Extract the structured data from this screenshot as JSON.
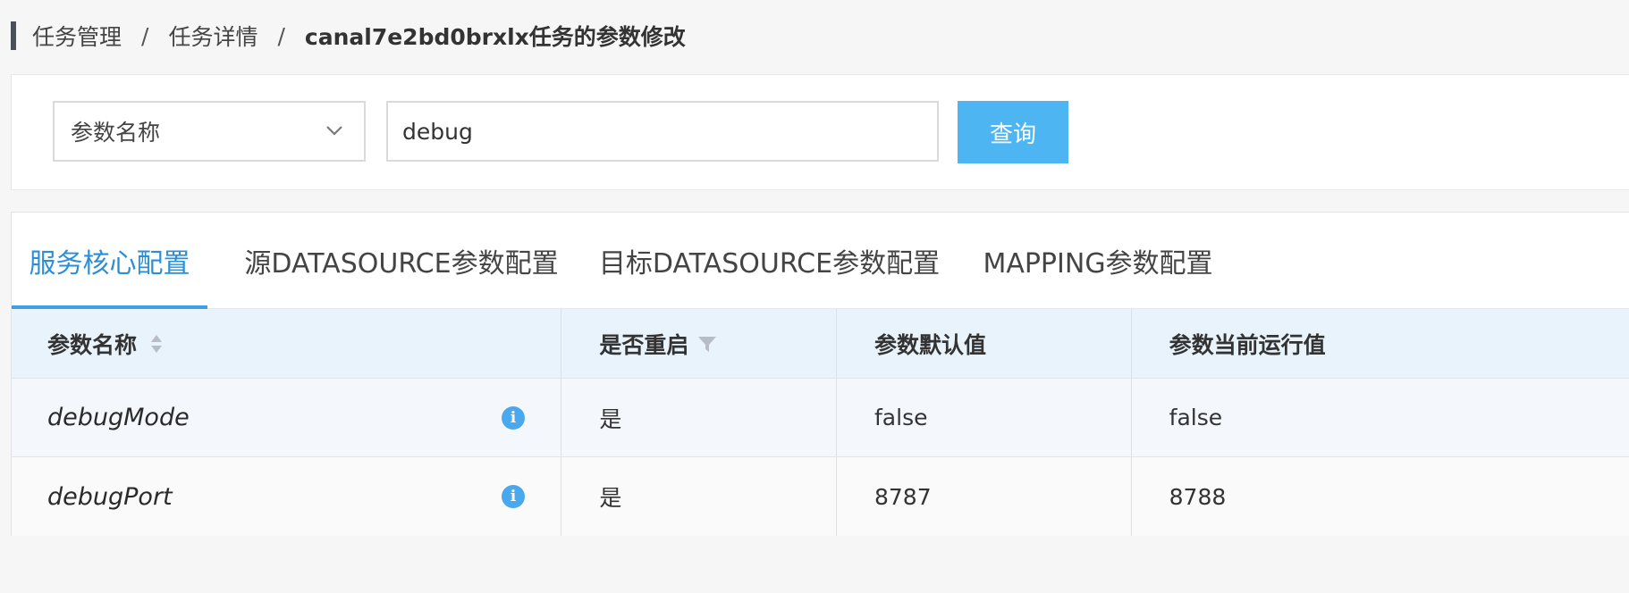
{
  "breadcrumb": {
    "items": [
      "任务管理",
      "任务详情"
    ],
    "separator": "/",
    "current": "canal7e2bd0brxlx任务的参数修改"
  },
  "search": {
    "select_value": "参数名称",
    "input_value": "debug",
    "query_label": "查询"
  },
  "tabs": [
    {
      "label": "服务核心配置",
      "active": true
    },
    {
      "label": "源DATASOURCE参数配置",
      "active": false
    },
    {
      "label": "目标DATASOURCE参数配置",
      "active": false
    },
    {
      "label": "MAPPING参数配置",
      "active": false
    }
  ],
  "table": {
    "columns": [
      "参数名称",
      "是否重启",
      "参数默认值",
      "参数当前运行值"
    ],
    "rows": [
      {
        "name": "debugMode",
        "restart": "是",
        "default": "false",
        "current": "false"
      },
      {
        "name": "debugPort",
        "restart": "是",
        "default": "8787",
        "current": "8788"
      }
    ]
  },
  "icons": {
    "select_chevron": "chevron-down-icon",
    "sort": "sort-icon",
    "filter": "filter-icon",
    "info": "info-icon"
  },
  "colors": {
    "accent": "#2b8fd8",
    "button": "#4db5f1",
    "header_bg": "#e9f3fc"
  }
}
